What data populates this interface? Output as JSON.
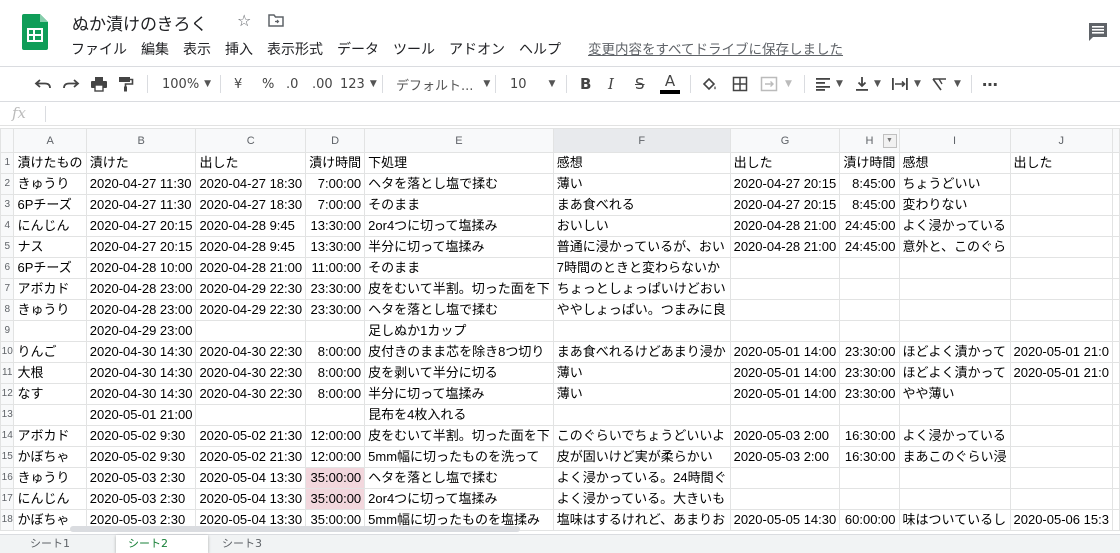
{
  "header": {
    "title": "ぬか漬けのきろく",
    "save_status": "変更内容をすべてドライブに保存しました",
    "menu": [
      "ファイル",
      "編集",
      "表示",
      "挿入",
      "表示形式",
      "データ",
      "ツール",
      "アドオン",
      "ヘルプ"
    ]
  },
  "toolbar": {
    "zoom": "100%",
    "currency": "¥",
    "percent": "%",
    "dec_decrease": ".0",
    "dec_increase": ".00",
    "format_more": "123",
    "font": "デフォルト...",
    "font_size": "10",
    "bold": "B",
    "italic": "I",
    "strike": "S",
    "text_color_glyph": "A",
    "text_color_bar": "#000000"
  },
  "formula_bar": {
    "fx": "fx",
    "value": ""
  },
  "colors": {
    "accent_green": "#0f9d58",
    "highlight_pink": "#f2d7dd"
  },
  "grid": {
    "columns": [
      "A",
      "B",
      "C",
      "D",
      "E",
      "F",
      "G",
      "H",
      "I",
      "J"
    ],
    "row_numbers": [
      "1",
      "2",
      "3",
      "4",
      "5",
      "6",
      "7",
      "8",
      "9",
      "10",
      "11",
      "12",
      "13",
      "14",
      "15",
      "16",
      "17",
      "18"
    ],
    "rows": [
      [
        "漬けたもの",
        "漬けた",
        "出した",
        "漬け時間",
        "下処理",
        "感想",
        "出した",
        "漬け時間",
        "感想",
        "出した"
      ],
      [
        "きゅうり",
        "2020-04-27 11:30",
        "2020-04-27 18:30",
        "7:00:00",
        "ヘタを落とし塩で揉む",
        "薄い",
        "2020-04-27 20:15",
        "8:45:00",
        "ちょうどいい",
        ""
      ],
      [
        "6Pチーズ",
        "2020-04-27 11:30",
        "2020-04-27 18:30",
        "7:00:00",
        "そのまま",
        "まあ食べれる",
        "2020-04-27 20:15",
        "8:45:00",
        "変わりない",
        ""
      ],
      [
        "にんじん",
        "2020-04-27 20:15",
        "2020-04-28 9:45",
        "13:30:00",
        "2or4つに切って塩揉み",
        "おいしい",
        "2020-04-28 21:00",
        "24:45:00",
        "よく浸かっている",
        ""
      ],
      [
        "ナス",
        "2020-04-27 20:15",
        "2020-04-28 9:45",
        "13:30:00",
        "半分に切って塩揉み",
        "普通に浸かっているが、おい",
        "2020-04-28 21:00",
        "24:45:00",
        "意外と、このぐら",
        ""
      ],
      [
        "6Pチーズ",
        "2020-04-28 10:00",
        "2020-04-28 21:00",
        "11:00:00",
        "そのまま",
        "7時間のときと変わらないか",
        "",
        "",
        "",
        ""
      ],
      [
        "アボカド",
        "2020-04-28 23:00",
        "2020-04-29 22:30",
        "23:30:00",
        "皮をむいて半割。切った面を下",
        "ちょっとしょっぱいけどおい",
        "",
        "",
        "",
        ""
      ],
      [
        "きゅうり",
        "2020-04-28 23:00",
        "2020-04-29 22:30",
        "23:30:00",
        "ヘタを落とし塩で揉む",
        "ややしょっぱい。つまみに良",
        "",
        "",
        "",
        ""
      ],
      [
        "",
        "2020-04-29 23:00",
        "",
        "",
        "足しぬか1カップ",
        "",
        "",
        "",
        "",
        ""
      ],
      [
        "りんご",
        "2020-04-30 14:30",
        "2020-04-30 22:30",
        "8:00:00",
        "皮付きのまま芯を除き8つ切り",
        "まあ食べれるけどあまり浸か",
        "2020-05-01 14:00",
        "23:30:00",
        "ほどよく漬かって",
        "2020-05-01 21:0"
      ],
      [
        "大根",
        "2020-04-30 14:30",
        "2020-04-30 22:30",
        "8:00:00",
        "皮を剥いて半分に切る",
        "薄い",
        "2020-05-01 14:00",
        "23:30:00",
        "ほどよく漬かって",
        "2020-05-01 21:0"
      ],
      [
        "なす",
        "2020-04-30 14:30",
        "2020-04-30 22:30",
        "8:00:00",
        "半分に切って塩揉み",
        "薄い",
        "2020-05-01 14:00",
        "23:30:00",
        "やや薄い",
        ""
      ],
      [
        "",
        "2020-05-01 21:00",
        "",
        "",
        "昆布を4枚入れる",
        "",
        "",
        "",
        "",
        ""
      ],
      [
        "アボカド",
        "2020-05-02 9:30",
        "2020-05-02 21:30",
        "12:00:00",
        "皮をむいて半割。切った面を下",
        "このぐらいでちょうどいいよ",
        "2020-05-03 2:00",
        "16:30:00",
        "よく浸かっている",
        ""
      ],
      [
        "かぼちゃ",
        "2020-05-02 9:30",
        "2020-05-02 21:30",
        "12:00:00",
        "5mm幅に切ったものを洗って",
        "皮が固いけど実が柔らかい",
        "2020-05-03 2:00",
        "16:30:00",
        "まあこのぐらい浸",
        ""
      ],
      [
        "きゅうり",
        "2020-05-03 2:30",
        "2020-05-04 13:30",
        "35:00:00",
        "ヘタを落とし塩で揉む",
        "よく浸かっている。24時間ぐ",
        "",
        "",
        "",
        ""
      ],
      [
        "にんじん",
        "2020-05-03 2:30",
        "2020-05-04 13:30",
        "35:00:00",
        "2or4つに切って塩揉み",
        "よく浸かっている。大きいも",
        "",
        "",
        "",
        ""
      ],
      [
        "かぼちゃ",
        "2020-05-03 2:30",
        "2020-05-04 13:30",
        "35:00:00",
        "5mm幅に切ったものを塩揉み",
        "塩味はするけれど、あまりお",
        "2020-05-05 14:30",
        "60:00:00",
        "味はついているし",
        "2020-05-06 15:3"
      ]
    ]
  },
  "sheets": [
    "シート1",
    "シート2",
    "シート3"
  ]
}
